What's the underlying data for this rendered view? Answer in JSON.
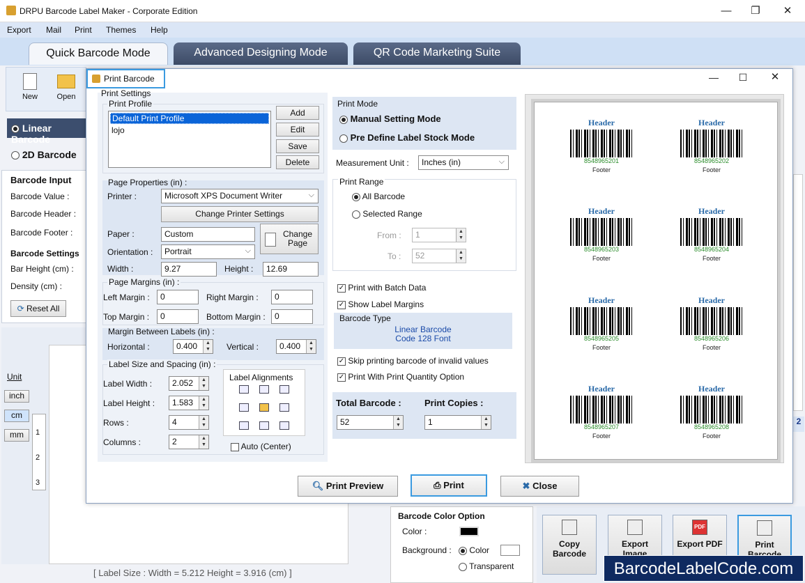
{
  "app": {
    "title": "DRPU Barcode Label Maker - Corporate Edition"
  },
  "menu": [
    "Export",
    "Mail",
    "Print",
    "Themes",
    "Help"
  ],
  "tabs": [
    "Quick Barcode Mode",
    "Advanced Designing Mode",
    "QR Code Marketing Suite"
  ],
  "toolbar": {
    "new": "New",
    "open": "Open"
  },
  "background": {
    "linear": "Linear Barcode",
    "twod": "2D Barcode",
    "barcode_input": "Barcode Input",
    "barcode_value": "Barcode Value :",
    "barcode_header": "Barcode Header :",
    "barcode_footer": "Barcode Footer :",
    "barcode_settings": "Barcode Settings",
    "bar_height": "Bar Height (cm) :",
    "density": "Density (cm) :",
    "reset_all": "Reset All",
    "unit": "Unit",
    "inch": "inch",
    "cm": "cm",
    "mm": "mm",
    "ruler": [
      "1",
      "2",
      "3"
    ],
    "label_size": "[ Label Size : Width = 5.212  Height = 3.916 (cm) ]",
    "color_option": "Barcode Color Option",
    "color_label": "Color :",
    "background_label": "Background :",
    "color_radio": "Color",
    "transparent_radio": "Transparent",
    "copy_barcode": "Copy Barcode",
    "export_image": "Export Image",
    "export_pdf": "Export PDF",
    "print_barcode": "Print Barcode",
    "pdf_badge": "PDF",
    "corner": "2",
    "watermark": "BarcodeLabelCode.com"
  },
  "dialog": {
    "title": "Print Barcode",
    "print_settings": "Print Settings",
    "print_profile": "Print Profile",
    "profiles": [
      "Default Print Profile",
      "lojo"
    ],
    "buttons": {
      "add": "Add",
      "edit": "Edit",
      "save": "Save",
      "delete": "Delete"
    },
    "page_properties": "Page Properties (in) :",
    "printer_label": "Printer :",
    "printer_value": "Microsoft XPS Document Writer",
    "change_printer": "Change Printer Settings",
    "paper_label": "Paper :",
    "paper_value": "Custom",
    "change_page": "Change Page",
    "orientation_label": "Orientation :",
    "orientation_value": "Portrait",
    "width_label": "Width :",
    "width_value": "9.27",
    "height_label": "Height :",
    "height_value": "12.69",
    "page_margins": "Page Margins (in) :",
    "left_margin": "Left Margin :",
    "left_value": "0",
    "right_margin": "Right Margin :",
    "right_value": "0",
    "top_margin": "Top Margin :",
    "top_value": "0",
    "bottom_margin": "Bottom Margin :",
    "bottom_value": "0",
    "margin_between": "Margin Between Labels (in) :",
    "horizontal": "Horizontal :",
    "horizontal_value": "0.400",
    "vertical": "Vertical :",
    "vertical_value": "0.400",
    "label_size_spacing": "Label Size and Spacing (in) :",
    "label_width": "Label Width :",
    "label_width_value": "2.052",
    "label_height": "Label Height :",
    "label_height_value": "1.583",
    "rows": "Rows :",
    "rows_value": "4",
    "columns": "Columns :",
    "columns_value": "2",
    "label_alignments": "Label Alignments",
    "auto_center": "Auto (Center)",
    "print_mode": "Print Mode",
    "manual_mode": "Manual Setting Mode",
    "predefine_mode": "Pre Define Label Stock Mode",
    "measurement_label": "Measurement Unit :",
    "measurement_value": "Inches (in)",
    "print_range": "Print Range",
    "all_barcode": "All Barcode",
    "selected_range": "Selected Range",
    "from_label": "From :",
    "from_value": "1",
    "to_label": "To :",
    "to_value": "52",
    "batch_data": "Print with Batch Data",
    "show_margins": "Show Label Margins",
    "barcode_type": "Barcode Type",
    "type_line1": "Linear Barcode",
    "type_line2": "Code 128 Font",
    "skip_invalid": "Skip printing barcode of invalid values",
    "print_quantity": "Print With Print Quantity Option",
    "total_barcode": "Total Barcode :",
    "total_value": "52",
    "print_copies": "Print Copies :",
    "copies_value": "1",
    "print_preview": "Print Preview",
    "print": "Print",
    "close": "Close"
  },
  "preview": {
    "header": "Header",
    "footer": "Footer",
    "numbers": [
      "8548965201",
      "8548965202",
      "8548965203",
      "8548965204",
      "8548965205",
      "8548965206",
      "8548965207",
      "8548965208"
    ]
  }
}
